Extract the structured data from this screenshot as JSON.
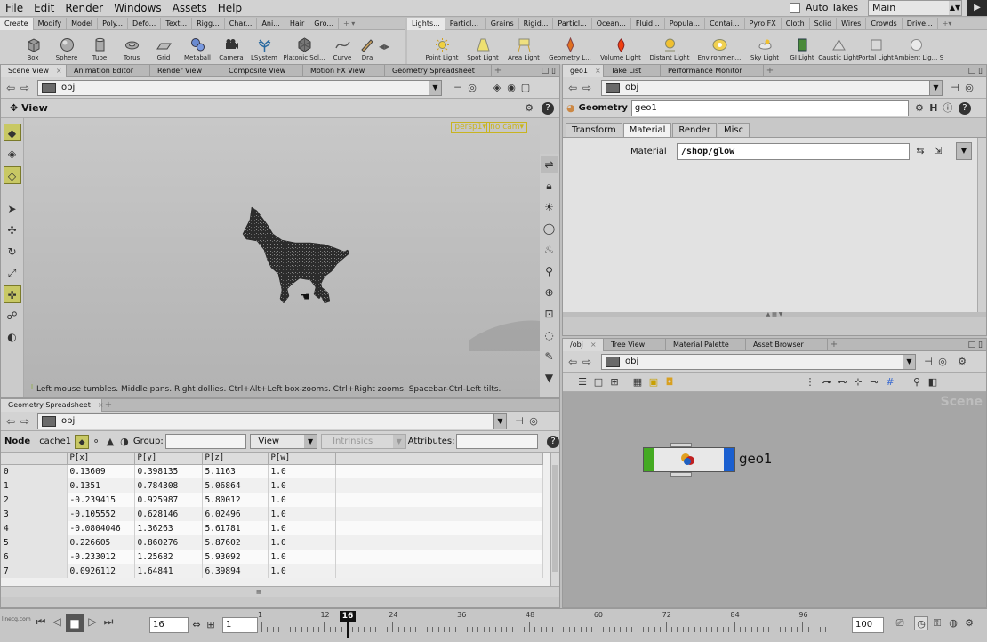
{
  "menubar": {
    "items": [
      "File",
      "Edit",
      "Render",
      "Windows",
      "Assets",
      "Help"
    ],
    "auto_takes": "Auto Takes",
    "desktop": "Main"
  },
  "shelf_left": {
    "tabs": [
      "Create",
      "Modify",
      "Model",
      "Poly...",
      "Defo...",
      "Text...",
      "Rigg...",
      "Char...",
      "Ani...",
      "Hair",
      "Gro..."
    ],
    "tools": [
      "Box",
      "Sphere",
      "Tube",
      "Torus",
      "Grid",
      "Metaball",
      "Camera",
      "LSystem",
      "Platonic Sol...",
      "Curve",
      "Dra"
    ]
  },
  "shelf_right": {
    "tabs": [
      "Lights...",
      "Particl...",
      "Grains",
      "Rigid...",
      "Particl...",
      "Ocean...",
      "Fluid...",
      "Popula...",
      "Contai...",
      "Pyro FX",
      "Cloth",
      "Solid",
      "Wires",
      "Crowds",
      "Drive..."
    ],
    "tools": [
      "Point Light",
      "Spot Light",
      "Area Light",
      "Geometry L...",
      "Volume Light",
      "Distant Light",
      "Environmen...",
      "Sky Light",
      "GI Light",
      "Caustic Light",
      "Portal Light",
      "Ambient Lig...",
      "S"
    ]
  },
  "viewer": {
    "tabs": [
      "Scene View",
      "Animation Editor",
      "Render View",
      "Composite View",
      "Motion FX View",
      "Geometry Spreadsheet"
    ],
    "path": "obj",
    "title": "View",
    "camera": "persp1",
    "cam2": "no cam",
    "hint": "Left mouse tumbles. Middle pans. Right dollies. Ctrl+Alt+Left box-zooms. Ctrl+Right zooms. Spacebar-Ctrl-Left tilts."
  },
  "spreadsheet": {
    "tab": "Geometry Spreadsheet",
    "path": "obj",
    "node_label": "Node",
    "node_value": "cache1",
    "group_label": "Group:",
    "view_label": "View",
    "intrinsics_label": "Intrinsics",
    "attributes_label": "Attributes:",
    "columns": [
      "P[x]",
      "P[y]",
      "P[z]",
      "P[w]"
    ],
    "rows": [
      [
        "0",
        "0.13609",
        "0.398135",
        "5.1163",
        "1.0"
      ],
      [
        "1",
        "0.1351",
        "0.784308",
        "5.06864",
        "1.0"
      ],
      [
        "2",
        "-0.239415",
        "0.925987",
        "5.80012",
        "1.0"
      ],
      [
        "3",
        "-0.105552",
        "0.628146",
        "6.02496",
        "1.0"
      ],
      [
        "4",
        "-0.0804046",
        "1.36263",
        "5.61781",
        "1.0"
      ],
      [
        "5",
        "0.226605",
        "0.860276",
        "5.87602",
        "1.0"
      ],
      [
        "6",
        "-0.233012",
        "1.25682",
        "5.93092",
        "1.0"
      ],
      [
        "7",
        "0.0926112",
        "1.64841",
        "6.39894",
        "1.0"
      ]
    ]
  },
  "params": {
    "tabs": [
      "geo1",
      "Take List",
      "Performance Monitor"
    ],
    "path": "obj",
    "type_label": "Geometry",
    "node_name": "geo1",
    "subtabs": [
      "Transform",
      "Material",
      "Render",
      "Misc"
    ],
    "active_subtab": "Material",
    "material_label": "Material",
    "material_value": "/shop/glow"
  },
  "network": {
    "tabs": [
      "/obj",
      "Tree View",
      "Material Palette",
      "Asset Browser"
    ],
    "path": "obj",
    "context_label": "Scene",
    "node_name": "geo1"
  },
  "timeline": {
    "current_frame": "16",
    "start_frame": "1",
    "end_frame": "100",
    "ticks": [
      "1",
      "12",
      "24",
      "36",
      "48",
      "60",
      "72",
      "84",
      "96"
    ],
    "playhead": "16",
    "watermark_text": "linecg.com"
  },
  "colors": {
    "display_flag": "#44aa22",
    "render_flag": "#1a5fd0",
    "viewport_bg": "#c8c8c8",
    "active_tool": "#c8c864"
  }
}
